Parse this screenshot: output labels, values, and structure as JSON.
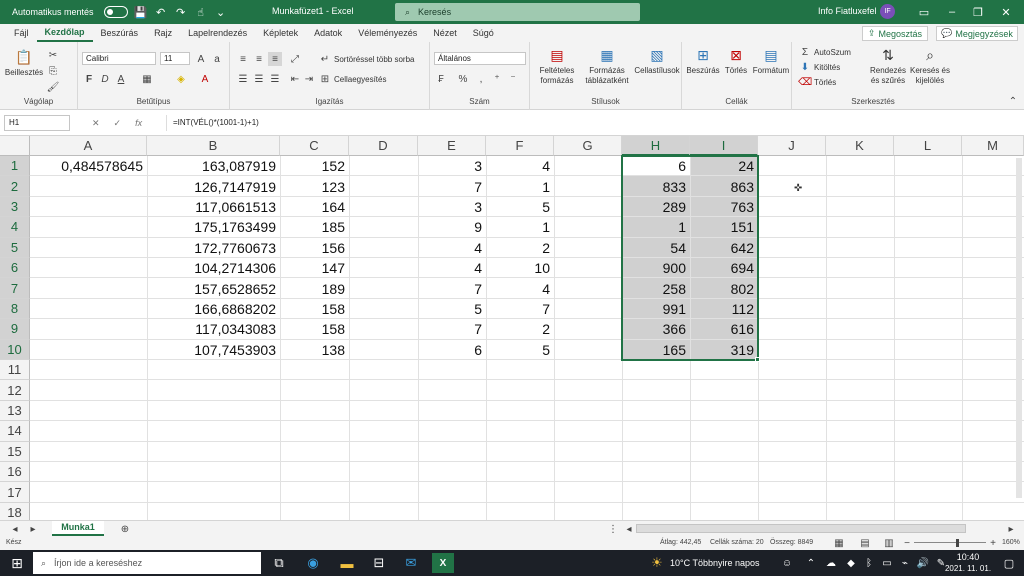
{
  "titlebar": {
    "autosave_label": "Automatikus mentés",
    "title": "Munkafüzet1 - Excel",
    "search_placeholder": "Keresés",
    "user_name": "Info Fiatluxefel",
    "avatar_initials": "IF"
  },
  "menu": {
    "items": [
      "Fájl",
      "Kezdőlap",
      "Beszúrás",
      "Rajz",
      "Lapelrendezés",
      "Képletek",
      "Adatok",
      "Véleményezés",
      "Nézet",
      "Súgó"
    ],
    "active": "Kezdőlap",
    "share_label": "Megosztás",
    "comments_label": "Megjegyzések"
  },
  "ribbon": {
    "clipboard": {
      "paste_label": "Beillesztés",
      "group_label": "Vágólap"
    },
    "font": {
      "font_name": "Calibri",
      "font_size": "11",
      "bold": "F",
      "italic": "D",
      "underline": "A",
      "group_label": "Betűtípus"
    },
    "alignment": {
      "wrap_label": "Sortöréssel több sorba",
      "merge_label": "Cellaegyesítés",
      "group_label": "Igazítás"
    },
    "number": {
      "format": "Általános",
      "group_label": "Szám"
    },
    "styles": {
      "conditional_label": "Feltételes formázás",
      "table_label": "Formázás táblázatként",
      "cellstyles_label": "Cellastílusok",
      "group_label": "Stílusok"
    },
    "cells": {
      "insert_label": "Beszúrás",
      "delete_label": "Törlés",
      "format_label": "Formátum",
      "group_label": "Cellák"
    },
    "editing": {
      "autosum_label": "AutoSzum",
      "fill_label": "Kitöltés",
      "clear_label": "Törlés",
      "sort_label": "Rendezés és szűrés",
      "find_label": "Keresés és kijelölés",
      "group_label": "Szerkesztés"
    }
  },
  "formula_bar": {
    "name_box": "H1",
    "formula": "=INT(VÉL()*(1001-1)+1)"
  },
  "grid": {
    "columns": [
      "A",
      "B",
      "C",
      "D",
      "E",
      "F",
      "G",
      "H",
      "I",
      "J",
      "K",
      "L",
      "M"
    ],
    "rows": [
      "1",
      "2",
      "3",
      "4",
      "5",
      "6",
      "7",
      "8",
      "9",
      "10",
      "11",
      "12",
      "13",
      "14",
      "15",
      "16",
      "17",
      "18"
    ],
    "A": [
      "0,484578645"
    ],
    "B": [
      "163,087919",
      "126,7147919",
      "117,0661513",
      "175,1763499",
      "172,7760673",
      "104,2714306",
      "157,6528652",
      "166,6868202",
      "117,0343083",
      "107,7453903"
    ],
    "C": [
      "152",
      "123",
      "164",
      "185",
      "156",
      "147",
      "189",
      "158",
      "158",
      "138"
    ],
    "E": [
      "3",
      "7",
      "3",
      "9",
      "4",
      "4",
      "7",
      "5",
      "7",
      "6"
    ],
    "F": [
      "4",
      "1",
      "5",
      "1",
      "2",
      "10",
      "4",
      "7",
      "2",
      "5"
    ],
    "H": [
      "6",
      "833",
      "289",
      "1",
      "54",
      "900",
      "258",
      "991",
      "366",
      "165"
    ],
    "I": [
      "24",
      "863",
      "763",
      "151",
      "642",
      "694",
      "802",
      "112",
      "616",
      "319"
    ]
  },
  "sheets": {
    "tabs": [
      "Munka1"
    ]
  },
  "status": {
    "ready": "Kész",
    "average": "Átlag: 442,45",
    "count": "Cellák száma: 20",
    "sum": "Összeg: 8849",
    "zoom": "160%"
  },
  "taskbar": {
    "search_placeholder": "Írjon ide a kereséshez",
    "weather": "10°C  Többnyire napos",
    "time": "10:40",
    "date": "2021. 11. 01."
  }
}
